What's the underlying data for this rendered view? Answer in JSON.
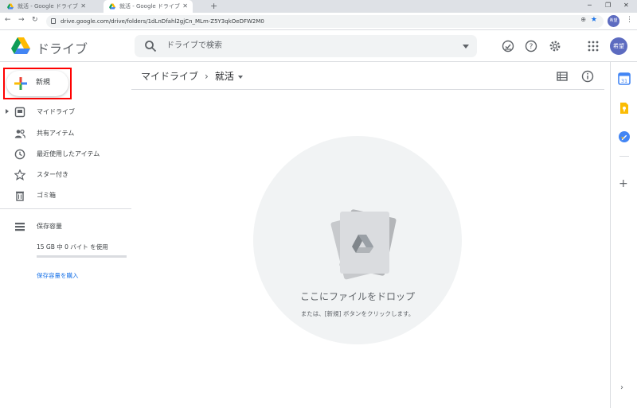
{
  "browser": {
    "tabs": [
      {
        "title": "就活 - Google ドライブ"
      },
      {
        "title": "就活 - Google ドライブ"
      }
    ],
    "new_tab_symbol": "+",
    "url": "drive.google.com/drive/folders/1dLnDfahl2gjCn_MLm-Z5Y3qkOeDFW2M0",
    "profile_initials": "希望"
  },
  "header": {
    "brand": "ドライブ",
    "search_placeholder": "ドライブで検索",
    "avatar_initials": "希望"
  },
  "sidebar": {
    "new_label": "新規",
    "items": [
      {
        "label": "マイドライブ",
        "icon": "my-drive-icon"
      },
      {
        "label": "共有アイテム",
        "icon": "shared-icon"
      },
      {
        "label": "最近使用したアイテム",
        "icon": "recent-icon"
      },
      {
        "label": "スター付き",
        "icon": "star-icon"
      },
      {
        "label": "ゴミ箱",
        "icon": "trash-icon"
      }
    ],
    "storage": {
      "label": "保存容量",
      "usage": "15 GB 中 0 バイト を使用",
      "used_fraction": 0,
      "buy_link": "保存容量を購入"
    }
  },
  "main": {
    "breadcrumb": {
      "root": "マイドライブ",
      "separator": "›",
      "current": "就活"
    },
    "dropzone": {
      "title": "ここにファイルをドロップ",
      "subtitle": "または、[新規] ボタンをクリックします。"
    }
  },
  "colors": {
    "accent": "#1a73e8",
    "highlight_box": "#ff0000",
    "avatar": "#5c6bc0"
  }
}
